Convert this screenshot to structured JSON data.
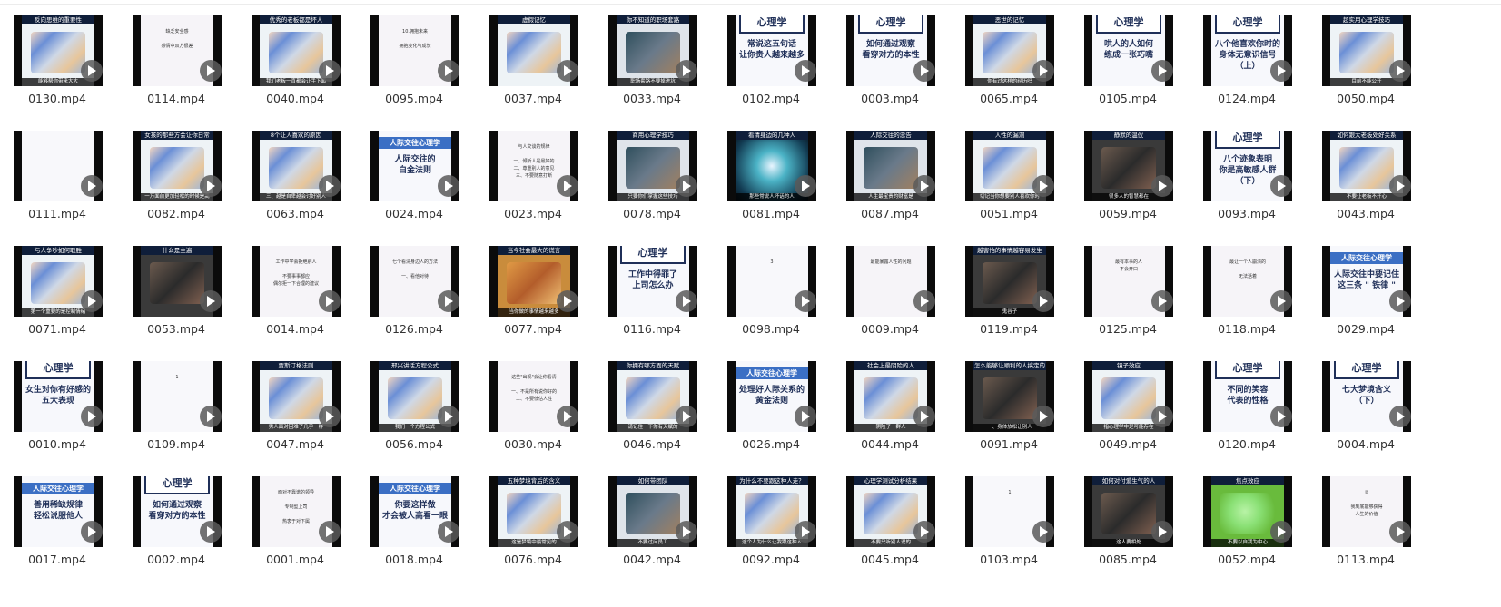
{
  "files": [
    {
      "name": "0130.mp4",
      "theme": "cartoon",
      "top": "反向思维的重要性",
      "bottom": "能够帮你带来大大"
    },
    {
      "name": "0114.mp4",
      "theme": "text",
      "top": "",
      "bottom": "",
      "body": "缺乏安全感\n\n感情中双方很差"
    },
    {
      "name": "0040.mp4",
      "theme": "cartoon",
      "top": "优秀的老板都是坏人",
      "bottom": "我们老板一直都会让手下面"
    },
    {
      "name": "0095.mp4",
      "theme": "text",
      "top": "",
      "bottom": "",
      "body": "10.拥抱未来\n\n拥抱变化与成长"
    },
    {
      "name": "0037.mp4",
      "theme": "cartoon",
      "top": "虚假记忆",
      "bottom": ""
    },
    {
      "name": "0033.mp4",
      "theme": "office",
      "top": "你不知道的职场套路",
      "bottom": "职场套路不要掉进坑"
    },
    {
      "name": "0102.mp4",
      "theme": "brand",
      "top": "",
      "bottom": "",
      "body": "常说这五句话\n让你贵人越来越多"
    },
    {
      "name": "0003.mp4",
      "theme": "brand",
      "top": "",
      "bottom": "",
      "body": "如何通过观察\n看穿对方的本性"
    },
    {
      "name": "0065.mp4",
      "theme": "cartoon",
      "top": "恶世的记忆",
      "bottom": "你有过这样的经历吗"
    },
    {
      "name": "0105.mp4",
      "theme": "brand",
      "top": "",
      "bottom": "",
      "body": "哄人的人如何\n练成一张巧嘴"
    },
    {
      "name": "0124.mp4",
      "theme": "brand",
      "top": "",
      "bottom": "",
      "body": "八个他喜欢你时的\n身体无意识信号\n（上）"
    },
    {
      "name": "0050.mp4",
      "theme": "cartoon",
      "top": "超实用心理学技巧",
      "bottom": "目前不能公开"
    },
    {
      "name": "0111.mp4",
      "theme": "white",
      "top": "",
      "bottom": "",
      "body": ""
    },
    {
      "name": "0082.mp4",
      "theme": "cartoon",
      "top": "女孩的那些方会让你日常",
      "bottom": "一万面前更加轻松的时候是高"
    },
    {
      "name": "0063.mp4",
      "theme": "cartoon",
      "top": "8个让人喜欢的原因",
      "bottom": "三、越是自卑越会讨好别人"
    },
    {
      "name": "0024.mp4",
      "theme": "blue",
      "top": "",
      "bottom": "",
      "banner": "人际交往心理学",
      "body": "人际交往的\n白金法则"
    },
    {
      "name": "0023.mp4",
      "theme": "text",
      "top": "",
      "bottom": "",
      "body": "与人交谈的规律\n\n一、倾听人是最好的\n二、尊重别人的意见\n三、不要随意打断"
    },
    {
      "name": "0078.mp4",
      "theme": "office",
      "top": "商用心理学技巧",
      "bottom": "只要你们掌握这些技巧"
    },
    {
      "name": "0081.mp4",
      "theme": "blur",
      "top": "看清身边的几种人",
      "bottom": "那些常说人坏话的人"
    },
    {
      "name": "0087.mp4",
      "theme": "office",
      "top": "人际交往的忠告",
      "bottom": "人生最宝贵的财富是"
    },
    {
      "name": "0051.mp4",
      "theme": "cartoon",
      "top": "人性的漏洞",
      "bottom": "切记当你想要别人喜欢你时"
    },
    {
      "name": "0059.mp4",
      "theme": "dark",
      "top": "静默的温仪",
      "bottom": "很多人的智慧都在"
    },
    {
      "name": "0093.mp4",
      "theme": "brand",
      "top": "",
      "bottom": "",
      "body": "八个迹象表明\n你是高敏感人群\n（下）"
    },
    {
      "name": "0043.mp4",
      "theme": "cartoon",
      "top": "如何跟大老板处好关系",
      "bottom": "不要让老板不开心"
    },
    {
      "name": "0071.mp4",
      "theme": "cartoon",
      "top": "与人争吵如何取胜",
      "bottom": "第一个重要的是控制情绪"
    },
    {
      "name": "0053.mp4",
      "theme": "dark",
      "top": "什么是主遍",
      "bottom": ""
    },
    {
      "name": "0014.mp4",
      "theme": "text",
      "top": "",
      "bottom": "",
      "body": "工作中学会拒绝别人\n\n不要事事都应\n偶尔拒一下合理的建议"
    },
    {
      "name": "0126.mp4",
      "theme": "text",
      "top": "",
      "bottom": "",
      "body": "七个看清身边人的方法\n\n一、看他对待"
    },
    {
      "name": "0077.mp4",
      "theme": "colorful",
      "top": "当今社会最大的谎言",
      "bottom": "当你做的事情越来越多"
    },
    {
      "name": "0116.mp4",
      "theme": "brand",
      "top": "",
      "bottom": "",
      "body": "工作中得罪了\n上司怎么办"
    },
    {
      "name": "0098.mp4",
      "theme": "white",
      "top": "",
      "bottom": "",
      "body": "3"
    },
    {
      "name": "0009.mp4",
      "theme": "text",
      "top": "",
      "bottom": "",
      "body": "最能暴露人性的问题\n\n"
    },
    {
      "name": "0119.mp4",
      "theme": "dark",
      "top": "越害怕的事情越容易发生",
      "bottom": "鬼谷子"
    },
    {
      "name": "0125.mp4",
      "theme": "text",
      "top": "",
      "bottom": "",
      "body": "最有本事的人\n不会开口"
    },
    {
      "name": "0118.mp4",
      "theme": "text",
      "top": "",
      "bottom": "",
      "body": "最让一个人崩溃的\n\n无法活着"
    },
    {
      "name": "0029.mp4",
      "theme": "blue",
      "top": "",
      "bottom": "",
      "banner": "人际交往心理学",
      "body": "人际交往中要记住\n这三条 \" 铁律 \""
    },
    {
      "name": "0010.mp4",
      "theme": "brand",
      "top": "",
      "bottom": "",
      "body": "女生对你有好感的\n五大表现"
    },
    {
      "name": "0109.mp4",
      "theme": "white",
      "top": "",
      "bottom": "",
      "body": "1"
    },
    {
      "name": "0047.mp4",
      "theme": "cartoon",
      "top": "贾斯汀格法则",
      "bottom": "男人面对困难了几乎一样"
    },
    {
      "name": "0056.mp4",
      "theme": "cartoon",
      "top": "邢兴讲话方程公式",
      "bottom": "我们一个方程公式"
    },
    {
      "name": "0030.mp4",
      "theme": "text",
      "top": "",
      "bottom": "",
      "body": "这些\"出现\"会让你看清\n\n一、不是所有说你好的\n二、不要低估人性"
    },
    {
      "name": "0046.mp4",
      "theme": "cartoon",
      "top": "你拥有哪方面的天赋",
      "bottom": "请记住一下你有天赋的"
    },
    {
      "name": "0026.mp4",
      "theme": "blue",
      "top": "",
      "bottom": "",
      "banner": "人际交往心理学",
      "body": "处理好人际关系的\n黄金法则"
    },
    {
      "name": "0044.mp4",
      "theme": "cartoon",
      "top": "社会上最阴险的人",
      "bottom": "阴险了一群人"
    },
    {
      "name": "0091.mp4",
      "theme": "dark",
      "top": "怎么能够让顺利的人搞定的",
      "bottom": "一、身体放松让别人"
    },
    {
      "name": "0049.mp4",
      "theme": "cartoon",
      "top": "镜子效应",
      "bottom": "指心理学中是可能存在"
    },
    {
      "name": "0120.mp4",
      "theme": "brand",
      "top": "",
      "bottom": "",
      "body": "不同的笑容\n代表的性格"
    },
    {
      "name": "0004.mp4",
      "theme": "brand",
      "top": "",
      "bottom": "",
      "body": "七大梦境含义\n（下）"
    },
    {
      "name": "0017.mp4",
      "theme": "blue",
      "top": "",
      "bottom": "",
      "banner": "人际交往心理学",
      "body": "善用稀缺规律\n轻松说服他人"
    },
    {
      "name": "0002.mp4",
      "theme": "brand",
      "top": "",
      "bottom": "",
      "body": "如何通过观察\n看穿对方的本性"
    },
    {
      "name": "0001.mp4",
      "theme": "text",
      "top": "",
      "bottom": "",
      "body": "面对不靠谱的领导\n\n专制型上司\n\n热衷于对下属"
    },
    {
      "name": "0018.mp4",
      "theme": "blue",
      "top": "",
      "bottom": "",
      "banner": "人际交往心理学",
      "body": "你要这样做\n才会被人高看一眼"
    },
    {
      "name": "0076.mp4",
      "theme": "cartoon",
      "top": "五种梦境背后的含义",
      "bottom": "这是梦境中最常见的"
    },
    {
      "name": "0042.mp4",
      "theme": "office",
      "top": "如何带团队",
      "bottom": "不要过问员工"
    },
    {
      "name": "0092.mp4",
      "theme": "cartoon",
      "top": "为什么不要跟这种人走？",
      "bottom": "这个人为什么让我跟这种人"
    },
    {
      "name": "0045.mp4",
      "theme": "cartoon",
      "top": "心理学测试分析结果",
      "bottom": "不要只听别人说的"
    },
    {
      "name": "0103.mp4",
      "theme": "white",
      "top": "",
      "bottom": "",
      "body": "1"
    },
    {
      "name": "0085.mp4",
      "theme": "dark",
      "top": "如何对付爱生气的人",
      "bottom": "这人要相处"
    },
    {
      "name": "0052.mp4",
      "theme": "green",
      "top": "焦点效应",
      "bottom": "不要以自我为中心"
    },
    {
      "name": "0113.mp4",
      "theme": "text",
      "top": "",
      "bottom": "",
      "body": "②\n\n我到底能够获得\n人生的价值"
    }
  ],
  "brand_banner": "心理学",
  "icons": {
    "play": "play-icon"
  }
}
